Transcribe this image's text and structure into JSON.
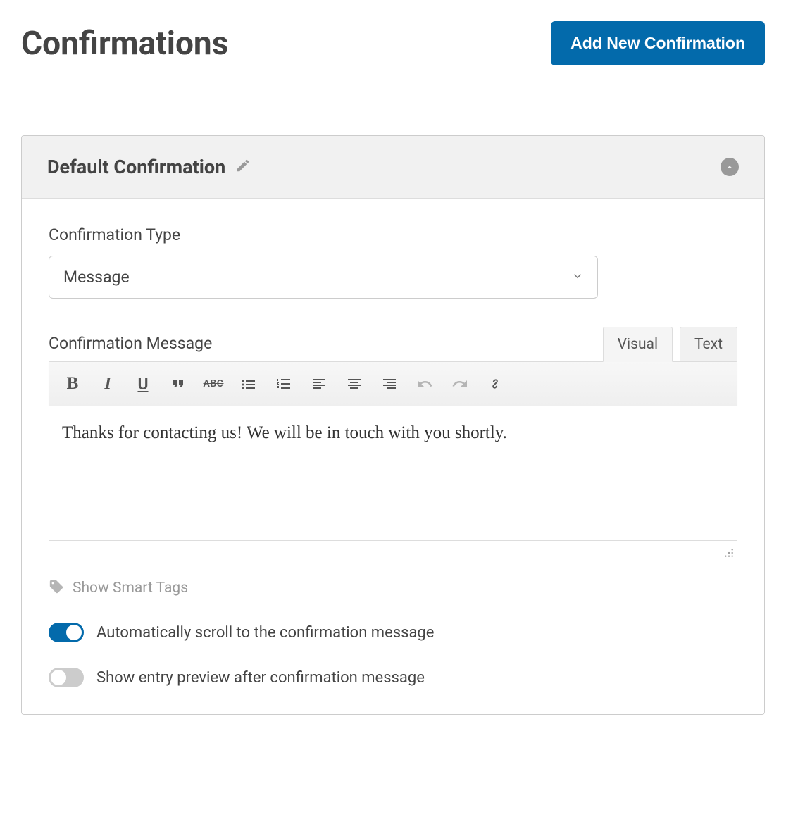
{
  "header": {
    "title": "Confirmations",
    "add_button_label": "Add New Confirmation"
  },
  "panel": {
    "title": "Default Confirmation",
    "fields": {
      "type_label": "Confirmation Type",
      "type_value": "Message",
      "message_label": "Confirmation Message",
      "message_value": "Thanks for contacting us! We will be in touch with you shortly."
    },
    "editor": {
      "tabs": {
        "visual": "Visual",
        "text": "Text"
      },
      "active_tab": "visual"
    },
    "smart_tags_label": "Show Smart Tags",
    "toggles": {
      "auto_scroll": {
        "label": "Automatically scroll to the confirmation message",
        "value": true
      },
      "entry_preview": {
        "label": "Show entry preview after confirmation message",
        "value": false
      }
    }
  },
  "icons": {
    "edit": "pencil-icon",
    "collapse": "chevron-up-icon",
    "caret": "chevron-down-icon",
    "tag": "tag-icon"
  },
  "colors": {
    "primary": "#036aab",
    "text": "#444444",
    "muted": "#999999",
    "border": "#cccccc"
  }
}
